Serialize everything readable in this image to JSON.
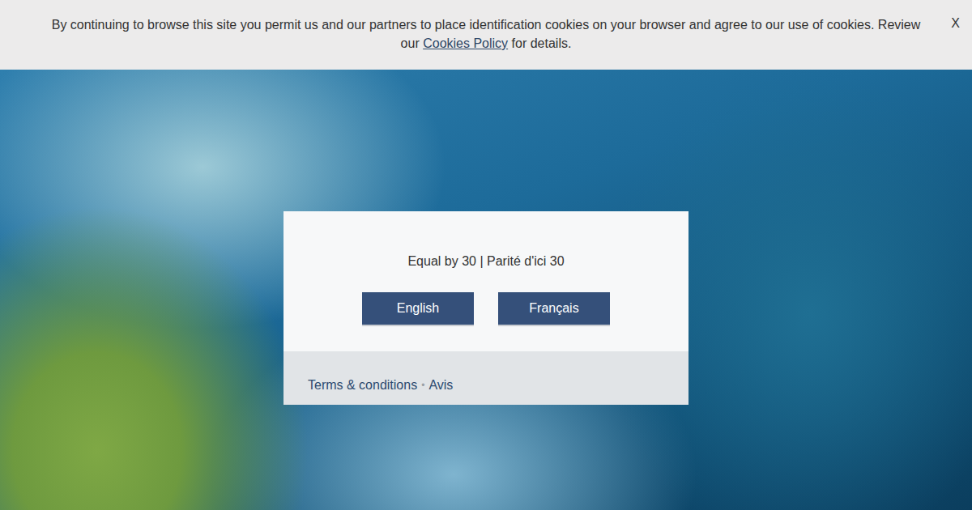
{
  "cookie_banner": {
    "text": "By continuing to browse this site you permit us and our partners to place identification cookies on your browser and agree to our use of cookies. Review our",
    "link": "Cookies Policy",
    "suffix": "for details.",
    "close": "X"
  },
  "dialog": {
    "title": "Equal by 30 | Parité d'ici 30",
    "buttons": [
      {
        "label": "English"
      },
      {
        "label": "Français"
      }
    ],
    "footer_links": [
      {
        "label": "Terms & conditions"
      },
      {
        "label": "Avis"
      }
    ],
    "separator": "•"
  }
}
